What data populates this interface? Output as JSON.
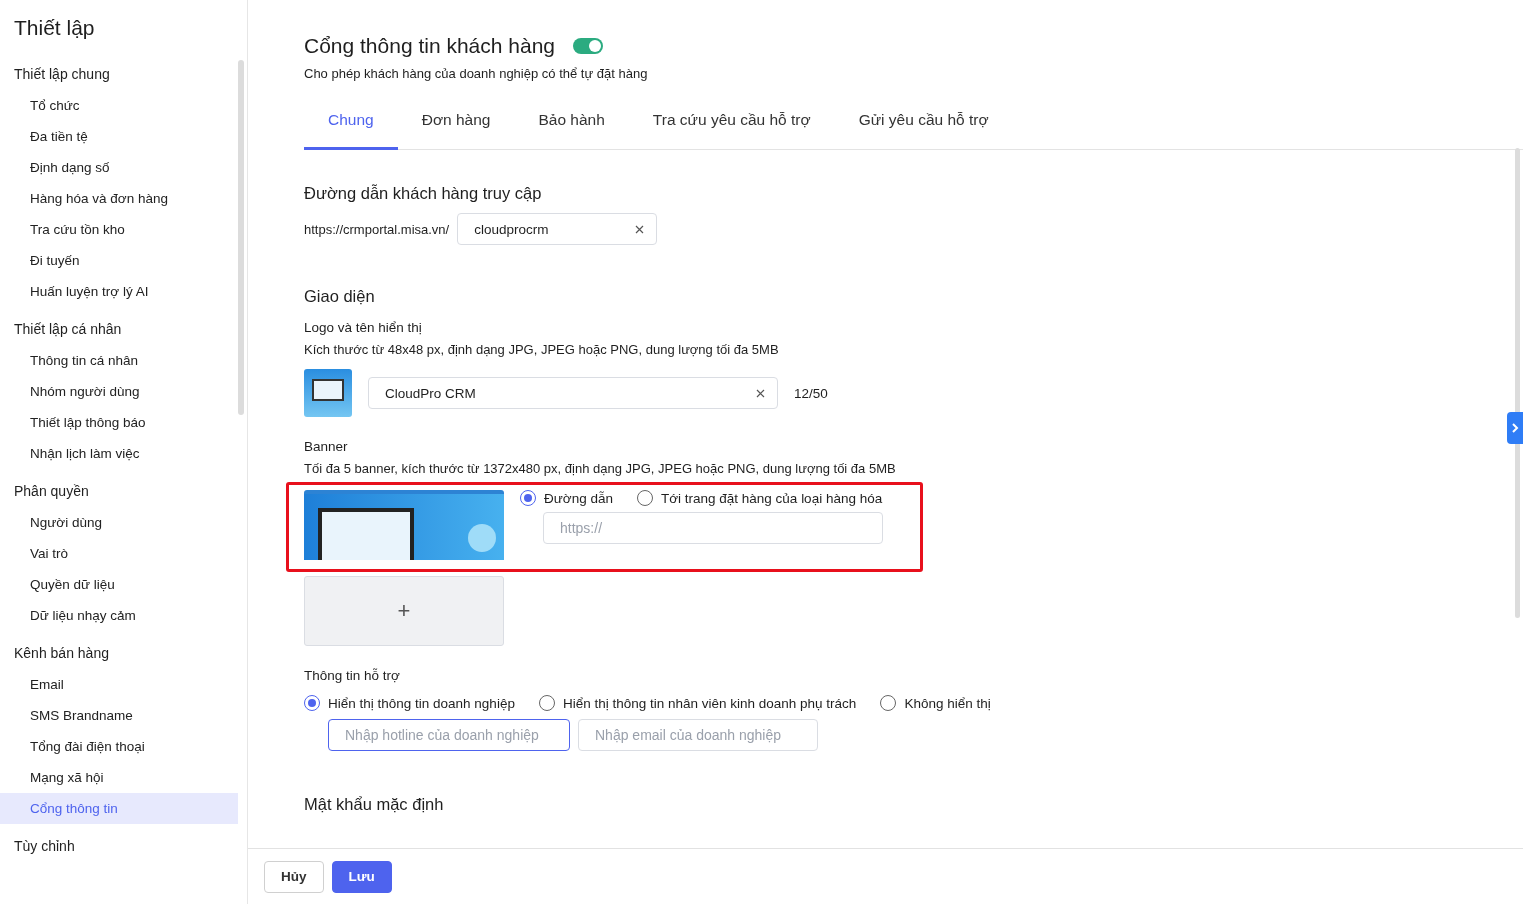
{
  "sidebar": {
    "title": "Thiết lập",
    "groups": [
      {
        "heading": "Thiết lập chung",
        "items": [
          {
            "label": "Tổ chức",
            "selected": false
          },
          {
            "label": "Đa tiền tệ",
            "selected": false
          },
          {
            "label": "Định dạng số",
            "selected": false
          },
          {
            "label": "Hàng hóa và đơn hàng",
            "selected": false
          },
          {
            "label": "Tra cứu tồn kho",
            "selected": false
          },
          {
            "label": "Đi tuyến",
            "selected": false
          },
          {
            "label": "Huấn luyện trợ lý AI",
            "selected": false
          }
        ]
      },
      {
        "heading": "Thiết lập cá nhân",
        "items": [
          {
            "label": "Thông tin cá nhân",
            "selected": false
          },
          {
            "label": "Nhóm người dùng",
            "selected": false
          },
          {
            "label": "Thiết lập thông báo",
            "selected": false
          },
          {
            "label": "Nhận lịch làm việc",
            "selected": false
          }
        ]
      },
      {
        "heading": "Phân quyền",
        "items": [
          {
            "label": "Người dùng",
            "selected": false
          },
          {
            "label": "Vai trò",
            "selected": false
          },
          {
            "label": "Quyền dữ liệu",
            "selected": false
          },
          {
            "label": "Dữ liệu nhạy cảm",
            "selected": false
          }
        ]
      },
      {
        "heading": "Kênh bán hàng",
        "items": [
          {
            "label": "Email",
            "selected": false
          },
          {
            "label": "SMS Brandname",
            "selected": false
          },
          {
            "label": "Tổng đài điện thoại",
            "selected": false
          },
          {
            "label": "Mạng xã hội",
            "selected": false
          },
          {
            "label": "Cổng thông tin",
            "selected": true
          }
        ]
      },
      {
        "heading": "Tùy chỉnh"
      }
    ]
  },
  "header": {
    "title": "Cổng thông tin khách hàng",
    "enabled": true,
    "subtitle": "Cho phép khách hàng của doanh nghiệp có thể tự đặt hàng"
  },
  "tabs": [
    {
      "label": "Chung",
      "selected": true
    },
    {
      "label": "Đơn hàng",
      "selected": false
    },
    {
      "label": "Bảo hành",
      "selected": false
    },
    {
      "label": "Tra cứu yêu cầu hỗ trợ",
      "selected": false
    },
    {
      "label": "Gửi yêu cầu hỗ trợ",
      "selected": false
    }
  ],
  "access_link": {
    "heading": "Đường dẫn khách hàng truy cập",
    "prefix": "https://crmportal.misa.vn/",
    "value": "cloudprocrm"
  },
  "appearance": {
    "heading": "Giao diện",
    "logo": {
      "label": "Logo và tên hiển thị",
      "hint": "Kích thước từ 48x48 px, định dạng JPG, JPEG hoặc PNG, dung lượng tối đa 5MB",
      "name": "CloudPro CRM",
      "count": "12/50"
    },
    "banner": {
      "label": "Banner",
      "hint": "Tối đa 5 banner, kích thước từ 1372x480 px, định dạng JPG, JPEG hoặc PNG, dung lượng tối đa 5MB",
      "options": [
        {
          "label": "Đường dẫn",
          "selected": true
        },
        {
          "label": "Tới trang đặt hàng của loại hàng hóa",
          "selected": false
        }
      ],
      "url_placeholder": "https://",
      "add_symbol": "+"
    }
  },
  "support": {
    "label": "Thông tin hỗ trợ",
    "options": [
      {
        "label": "Hiển thị thông tin doanh nghiệp",
        "selected": true
      },
      {
        "label": "Hiển thị thông tin nhân viên kinh doanh phụ trách",
        "selected": false
      },
      {
        "label": "Không hiển thị",
        "selected": false
      }
    ],
    "hotline_placeholder": "Nhập hotline của doanh nghiệp",
    "email_placeholder": "Nhập email của doanh nghiệp"
  },
  "password": {
    "heading": "Mật khẩu mặc định"
  },
  "footer": {
    "buttons": [
      {
        "label": "Hủy",
        "kind": "secondary"
      },
      {
        "label": "Lưu",
        "kind": "primary"
      }
    ]
  }
}
